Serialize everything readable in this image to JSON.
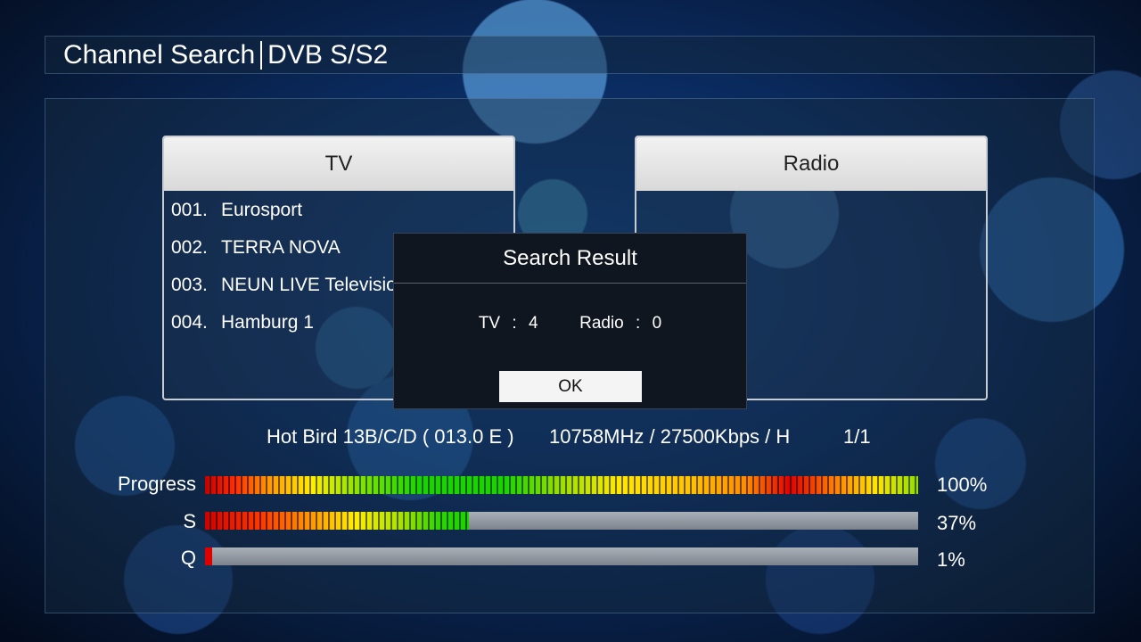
{
  "header": {
    "title": "Channel Search",
    "subtitle": "DVB S/S2"
  },
  "tv_list": {
    "header": "TV",
    "channels": [
      {
        "num": "001.",
        "name": "Eurosport"
      },
      {
        "num": "002.",
        "name": "TERRA NOVA"
      },
      {
        "num": "003.",
        "name": "NEUN LIVE Televisio"
      },
      {
        "num": "004.",
        "name": "Hamburg 1"
      }
    ]
  },
  "radio_list": {
    "header": "Radio",
    "channels": []
  },
  "dialog": {
    "title": "Search Result",
    "tv_label": "TV",
    "tv_count": "4",
    "radio_label": "Radio",
    "radio_count": "0",
    "ok_label": "OK"
  },
  "transponder": {
    "satellite": "Hot Bird 13B/C/D ( 013.0 E )",
    "params": "10758MHz / 27500Kbps / H",
    "index": "1/1"
  },
  "meters": {
    "progress": {
      "label": "Progress",
      "value": "100%",
      "fraction": 1.0
    },
    "strength": {
      "label": "S",
      "value": "37%",
      "fraction": 0.37
    },
    "quality": {
      "label": "Q",
      "value": "1%",
      "fraction": 0.01
    }
  }
}
